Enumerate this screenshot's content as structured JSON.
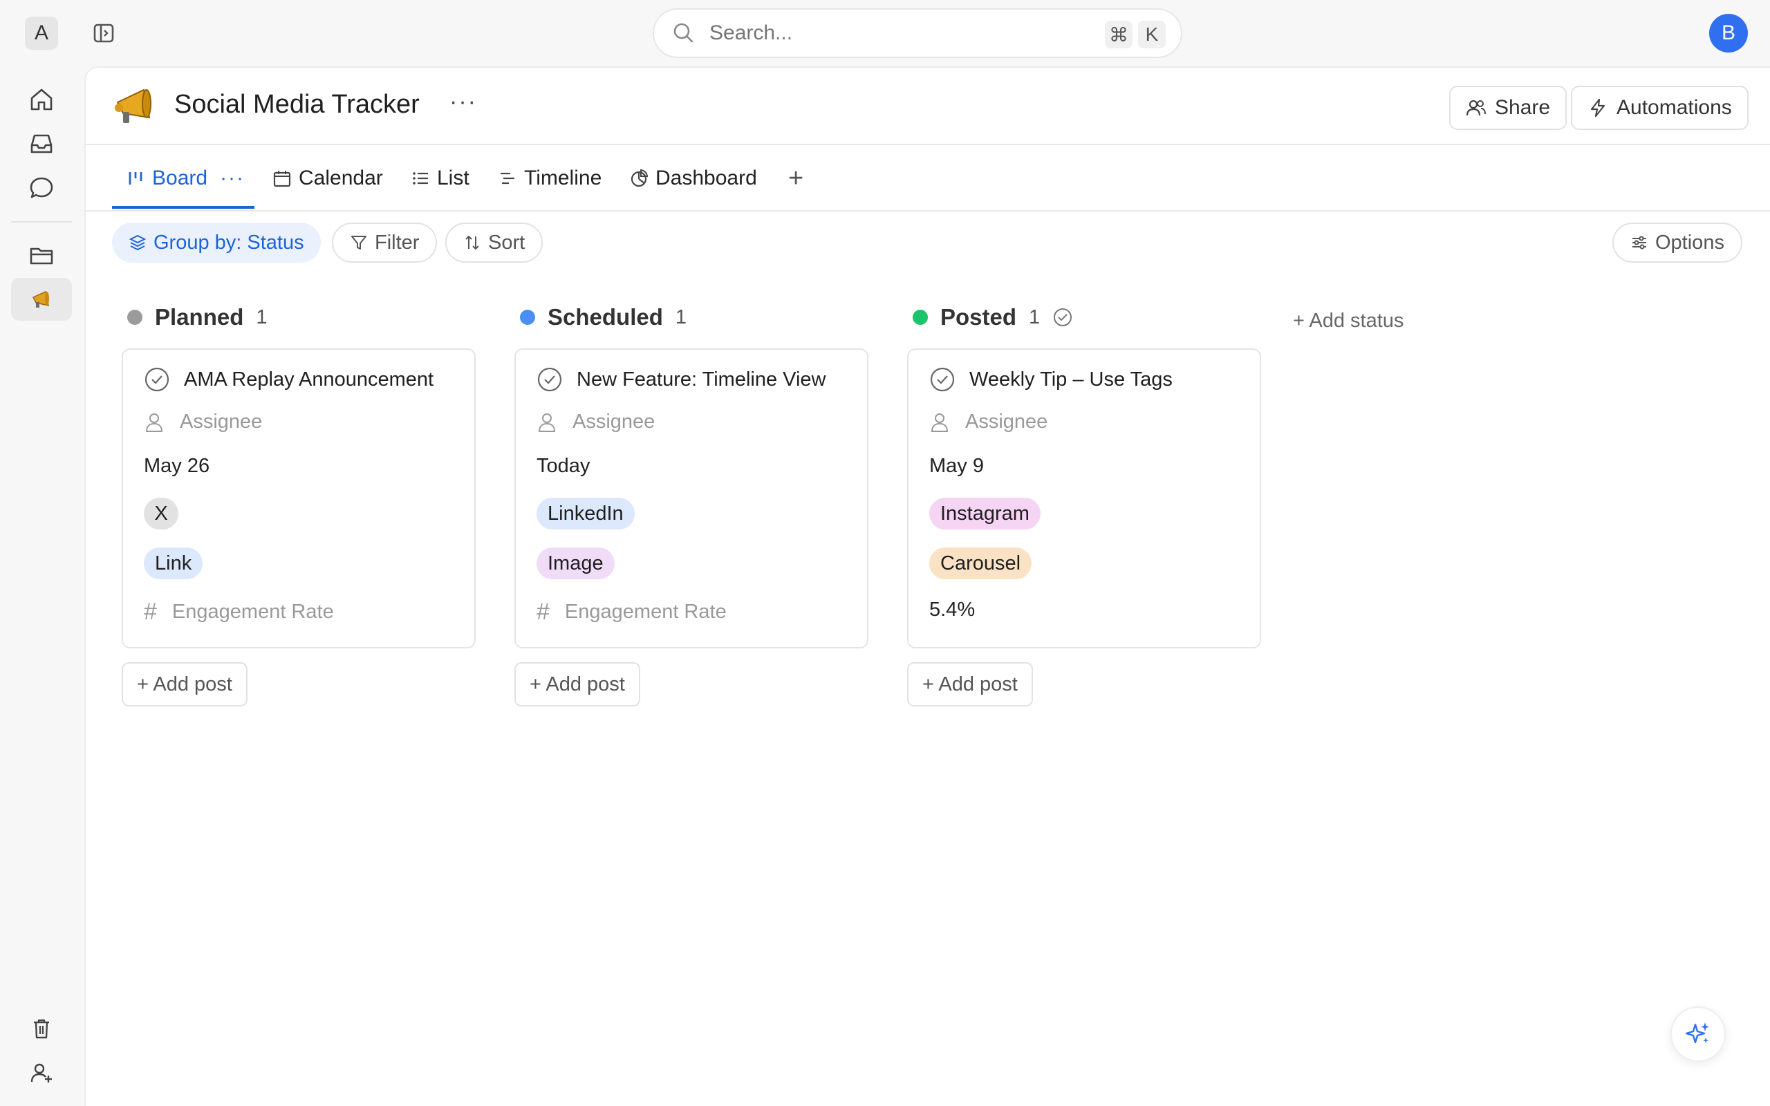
{
  "workspace": {
    "initial": "A"
  },
  "user": {
    "initial": "B"
  },
  "search": {
    "placeholder": "Search...",
    "shortcut_mod": "⌘",
    "shortcut_key": "K"
  },
  "page": {
    "title": "Social Media Tracker",
    "emoji": "megaphone-icon"
  },
  "header_actions": {
    "share": "Share",
    "automations": "Automations"
  },
  "tabs": [
    {
      "label": "Board",
      "active": true
    },
    {
      "label": "Calendar"
    },
    {
      "label": "List"
    },
    {
      "label": "Timeline"
    },
    {
      "label": "Dashboard"
    }
  ],
  "toolbar": {
    "group_by": "Group by: Status",
    "filter": "Filter",
    "sort": "Sort",
    "options": "Options"
  },
  "columns": [
    {
      "name": "Planned",
      "count": "1",
      "color": "#9b9b9b",
      "card": {
        "title": "AMA Replay Announcement",
        "assignee": "Assignee",
        "date": "May 26",
        "platform": "X",
        "format": "Link",
        "engagement": "Engagement Rate"
      }
    },
    {
      "name": "Scheduled",
      "count": "1",
      "color": "#4a90f0",
      "card": {
        "title": "New Feature: Timeline View",
        "assignee": "Assignee",
        "date": "Today",
        "platform": "LinkedIn",
        "format": "Image",
        "engagement": "Engagement Rate"
      }
    },
    {
      "name": "Posted",
      "count": "1",
      "color": "#19c46a",
      "card": {
        "title": "Weekly Tip – Use Tags",
        "assignee": "Assignee",
        "date": "May 9",
        "platform": "Instagram",
        "format": "Carousel",
        "engagement": "5.4%"
      }
    }
  ],
  "add_post_label": "+ Add post",
  "add_status_label": "+ Add status",
  "colors": {
    "accent": "#1d63d8",
    "linkedin_tag": "#dce8fb",
    "link_tag": "#dce8fb",
    "image_tag": "#f1dcf8",
    "instagram_tag": "#f6d4f4",
    "carousel_tag": "#fbe2c4",
    "x_tag": "#e2e2e2"
  }
}
